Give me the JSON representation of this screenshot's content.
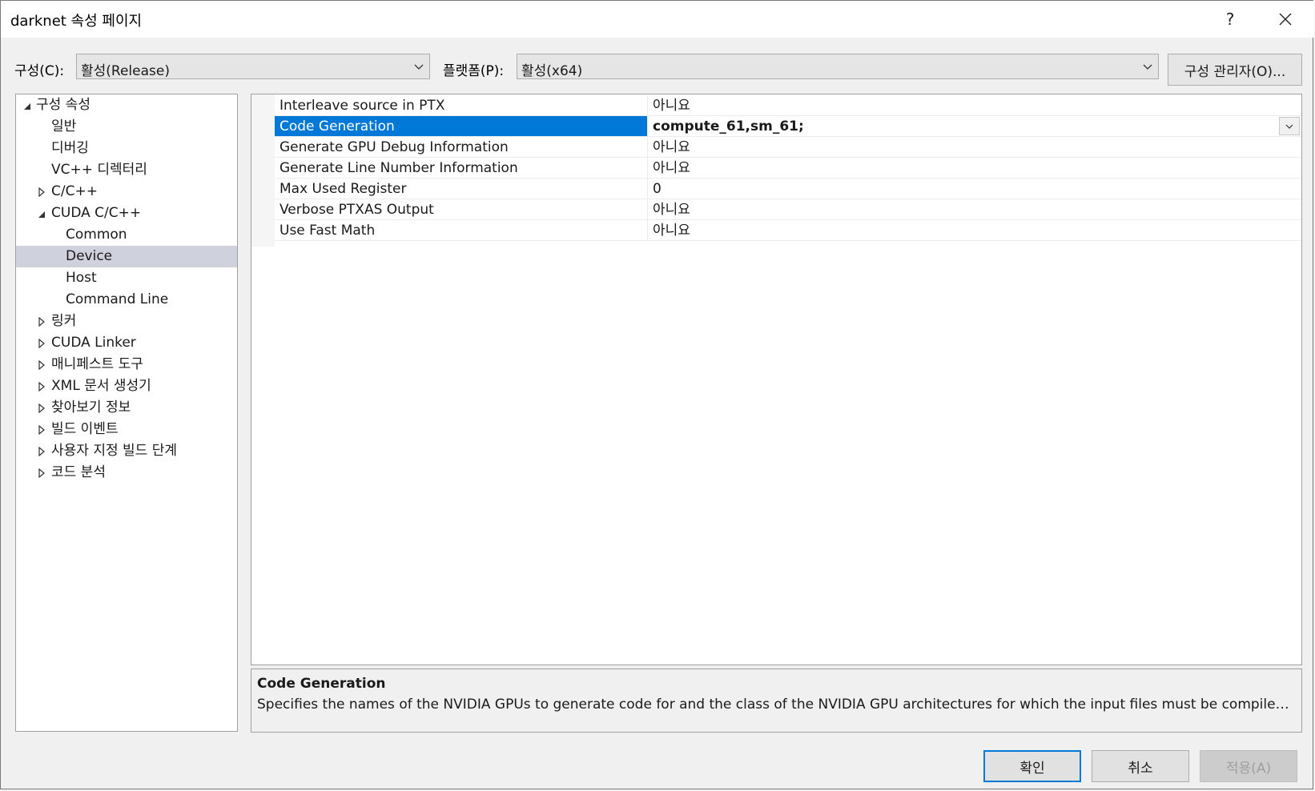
{
  "window": {
    "title": "darknet 속성 페이지",
    "help_label": "?"
  },
  "config": {
    "config_label": "구성(C):",
    "config_value": "활성(Release)",
    "platform_label": "플랫폼(P):",
    "platform_value": "활성(x64)",
    "manager_label": "구성 관리자(O)..."
  },
  "tree": {
    "items": [
      {
        "label": "구성 속성",
        "expanded": true
      },
      {
        "label": "일반"
      },
      {
        "label": "디버깅"
      },
      {
        "label": "VC++ 디렉터리"
      },
      {
        "label": "C/C++",
        "expanded": false
      },
      {
        "label": "CUDA C/C++",
        "expanded": true
      },
      {
        "label": "Common"
      },
      {
        "label": "Device",
        "selected": true
      },
      {
        "label": "Host"
      },
      {
        "label": "Command Line"
      },
      {
        "label": "링커",
        "expanded": false
      },
      {
        "label": "CUDA Linker",
        "expanded": false
      },
      {
        "label": "매니페스트 도구",
        "expanded": false
      },
      {
        "label": "XML 문서 생성기",
        "expanded": false
      },
      {
        "label": "찾아보기 정보",
        "expanded": false
      },
      {
        "label": "빌드 이벤트",
        "expanded": false
      },
      {
        "label": "사용자 지정 빌드 단계",
        "expanded": false
      },
      {
        "label": "코드 분석",
        "expanded": false
      }
    ]
  },
  "properties": [
    {
      "name": "Interleave source in PTX",
      "value": "아니요"
    },
    {
      "name": "Code Generation",
      "value": "compute_61,sm_61;",
      "selected": true
    },
    {
      "name": "Generate GPU Debug Information",
      "value": "아니요"
    },
    {
      "name": "Generate Line Number Information",
      "value": "아니요"
    },
    {
      "name": "Max Used Register",
      "value": "0"
    },
    {
      "name": "Verbose PTXAS Output",
      "value": "아니요"
    },
    {
      "name": "Use Fast Math",
      "value": "아니요"
    }
  ],
  "description": {
    "title": "Code Generation",
    "text": "Specifies the names of the NVIDIA GPUs to generate code for and the class of the NVIDIA GPU architectures for which the input files must be compiled.  S..."
  },
  "buttons": {
    "ok": "확인",
    "cancel": "취소",
    "apply": "적용(A)"
  },
  "colors": {
    "selection_blue": "#0078d7",
    "tree_selected": "#cfd2dc"
  }
}
